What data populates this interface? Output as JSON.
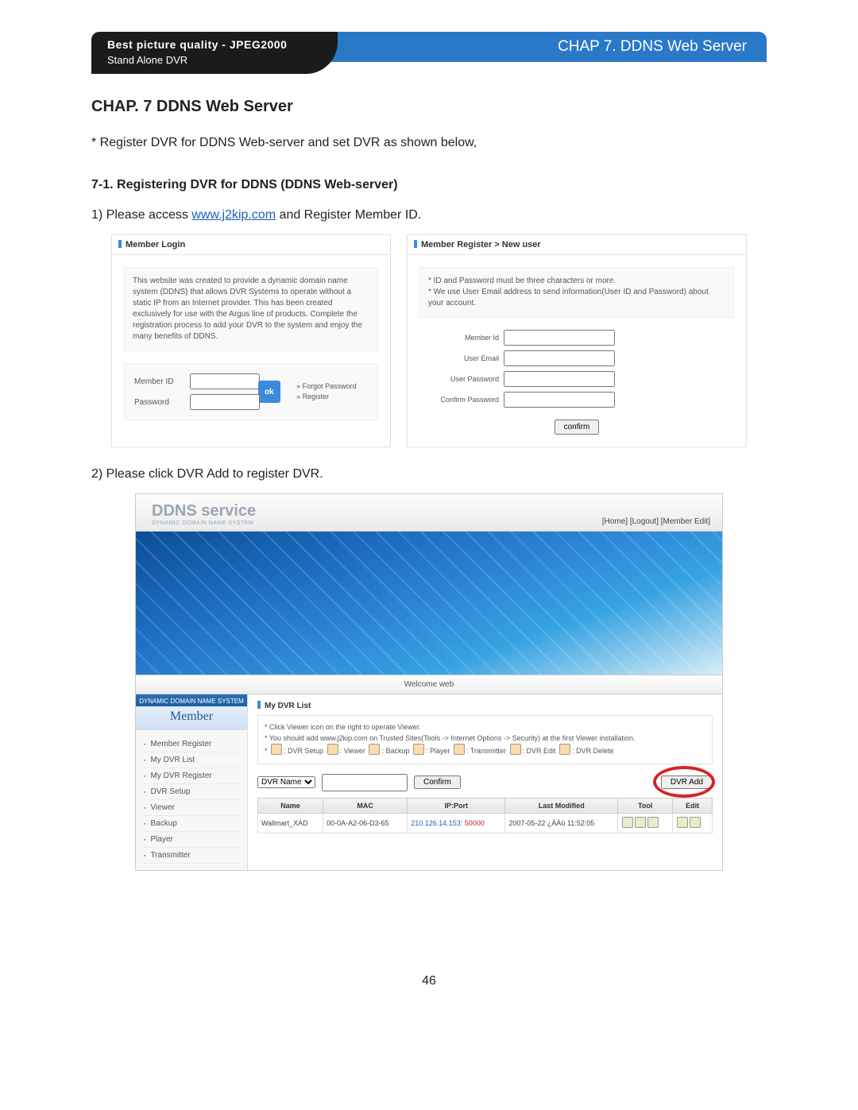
{
  "header": {
    "tagline_line1": "Best picture quality - JPEG2000",
    "tagline_line2": "Stand Alone DVR",
    "chapter_banner": "CHAP 7. DDNS Web Server"
  },
  "chapter_title": "CHAP. 7   DDNS Web Server",
  "intro_line": "* Register DVR for DDNS Web-server and set DVR as shown below,",
  "section71": "7-1. Registering DVR for DDNS (DDNS Web-server)",
  "step1_prefix": "1) Please access ",
  "step1_link": "www.j2kip.com",
  "step1_suffix": " and Register Member ID.",
  "login_panel": {
    "title": "Member Login",
    "desc": "This website was created to provide a dynamic domain name system (DDNS) that allows DVR Systems to operate without a static IP from an Internet provider. This has been created exclusively for use with the Argus line of products. Complete the registration process to add your DVR to the system and enjoy the many benefits of DDNS.",
    "member_id": "Member ID",
    "password": "Password",
    "ok": "ok",
    "forgot": "» Forgot Password",
    "register": "» Register"
  },
  "register_panel": {
    "title": "Member Register > New user",
    "note1": "* ID and Password must be three characters or more.",
    "note2": "* We use User Email address to send information(User ID and Password) about your account.",
    "member_id": "Member Id",
    "user_email": "User Email",
    "user_password": "User Password",
    "confirm_password": "Confirm Password",
    "confirm": "confirm"
  },
  "step2": "2) Please click DVR Add to register DVR.",
  "ddns": {
    "title": "DDNS service",
    "subtitle": "DYNAMIC DOMAIN NAME SYSTEM",
    "links": "[Home] [Logout] [Member Edit]",
    "welcome": "Welcome web",
    "side_top": "DYNAMIC DOMAIN NAME SYSTEM",
    "side_member": "Member",
    "side_items": [
      "Member Register",
      "My DVR List",
      "My DVR Register",
      "DVR Setup",
      "Viewer",
      "Backup",
      "Player",
      "Transmitter"
    ],
    "content_title": "My DVR List",
    "note_a": "* Click Viewer icon on the right to operate Viewer.",
    "note_b": "* You should add www.j2kip.com on Trusted Sites(Tools -> Internet Options -> Security) at the first Viewer installation.",
    "legend": {
      "setup": ": DVR Setup",
      "viewer": ": Viewer",
      "backup": ": Backup",
      "player": ": Player",
      "transmitter": ": Transmitter",
      "edit": ": DVR Edit",
      "delete": ": DVR Delete"
    },
    "toolbar": {
      "dvr_name": "DVR Name",
      "confirm": "Confirm",
      "dvr_add": "DVR Add"
    },
    "table": {
      "headers": [
        "Name",
        "MAC",
        "IP:Port",
        "Last Modified",
        "Tool",
        "Edit"
      ],
      "row": {
        "name": "Wallmart_XAD",
        "mac": "00-0A-A2-06-D3-65",
        "ip": "210.126.14.153",
        "port": "50000",
        "last": "2007-05-22 ¿ÀÀü 11:52:05"
      }
    }
  },
  "page_number": "46"
}
